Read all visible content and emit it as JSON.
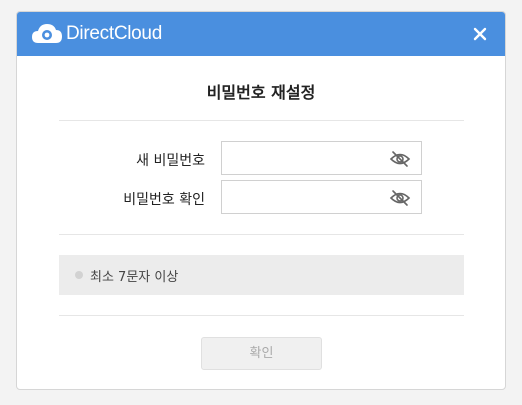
{
  "header": {
    "brand": "DirectCloud",
    "accent_color": "#4a8fdf",
    "close_icon": "close-icon"
  },
  "dialog": {
    "title": "비밀번호 재설정",
    "fields": [
      {
        "label": "새 비밀번호",
        "value": "",
        "icon": "eye-slash-icon"
      },
      {
        "label": "비밀번호 확인",
        "value": "",
        "icon": "eye-slash-icon"
      }
    ],
    "rules": [
      {
        "text": "최소 7문자 이상"
      }
    ],
    "confirm_label": "확인"
  }
}
